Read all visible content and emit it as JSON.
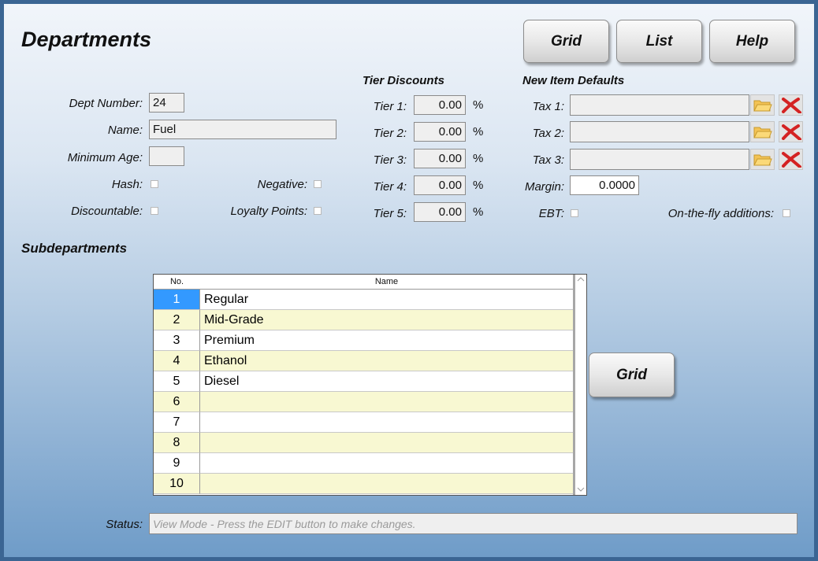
{
  "title": "Departments",
  "top_buttons": {
    "grid": "Grid",
    "list": "List",
    "help": "Help"
  },
  "fields": {
    "dept_number_label": "Dept Number:",
    "dept_number": "24",
    "name_label": "Name:",
    "name": "Fuel",
    "min_age_label": "Minimum Age:",
    "min_age": "",
    "hash_label": "Hash:",
    "negative_label": "Negative:",
    "discountable_label": "Discountable:",
    "loyalty_label": "Loyalty Points:"
  },
  "tier": {
    "header": "Tier Discounts",
    "rows": [
      {
        "label": "Tier 1:",
        "value": "0.00",
        "unit": "%"
      },
      {
        "label": "Tier 2:",
        "value": "0.00",
        "unit": "%"
      },
      {
        "label": "Tier 3:",
        "value": "0.00",
        "unit": "%"
      },
      {
        "label": "Tier 4:",
        "value": "0.00",
        "unit": "%"
      },
      {
        "label": "Tier 5:",
        "value": "0.00",
        "unit": "%"
      }
    ]
  },
  "defaults": {
    "header": "New Item Defaults",
    "tax1_label": "Tax 1:",
    "tax1": "",
    "tax2_label": "Tax 2:",
    "tax2": "",
    "tax3_label": "Tax 3:",
    "tax3": "",
    "margin_label": "Margin:",
    "margin": "0.0000",
    "ebt_label": "EBT:",
    "otf_label": "On-the-fly additions:"
  },
  "subdepartments": {
    "header": "Subdepartments",
    "columns": [
      "No.",
      "Name"
    ],
    "rows": [
      {
        "no": "1",
        "name": "Regular"
      },
      {
        "no": "2",
        "name": "Mid-Grade"
      },
      {
        "no": "3",
        "name": "Premium"
      },
      {
        "no": "4",
        "name": "Ethanol"
      },
      {
        "no": "5",
        "name": "Diesel"
      },
      {
        "no": "6",
        "name": ""
      },
      {
        "no": "7",
        "name": ""
      },
      {
        "no": "8",
        "name": ""
      },
      {
        "no": "9",
        "name": ""
      },
      {
        "no": "10",
        "name": ""
      }
    ],
    "grid_button": "Grid"
  },
  "status": {
    "label": "Status:",
    "text": "View Mode - Press the EDIT button to make changes."
  },
  "colors": {
    "row_alt": "#f8f8d2",
    "row_selected": "#3399ff",
    "background_top": "#f1f5fa",
    "background_bottom": "#6f9cc8"
  },
  "icons": [
    "folder-icon",
    "clear-x-icon",
    "scroll-up-icon",
    "scroll-down-icon"
  ]
}
